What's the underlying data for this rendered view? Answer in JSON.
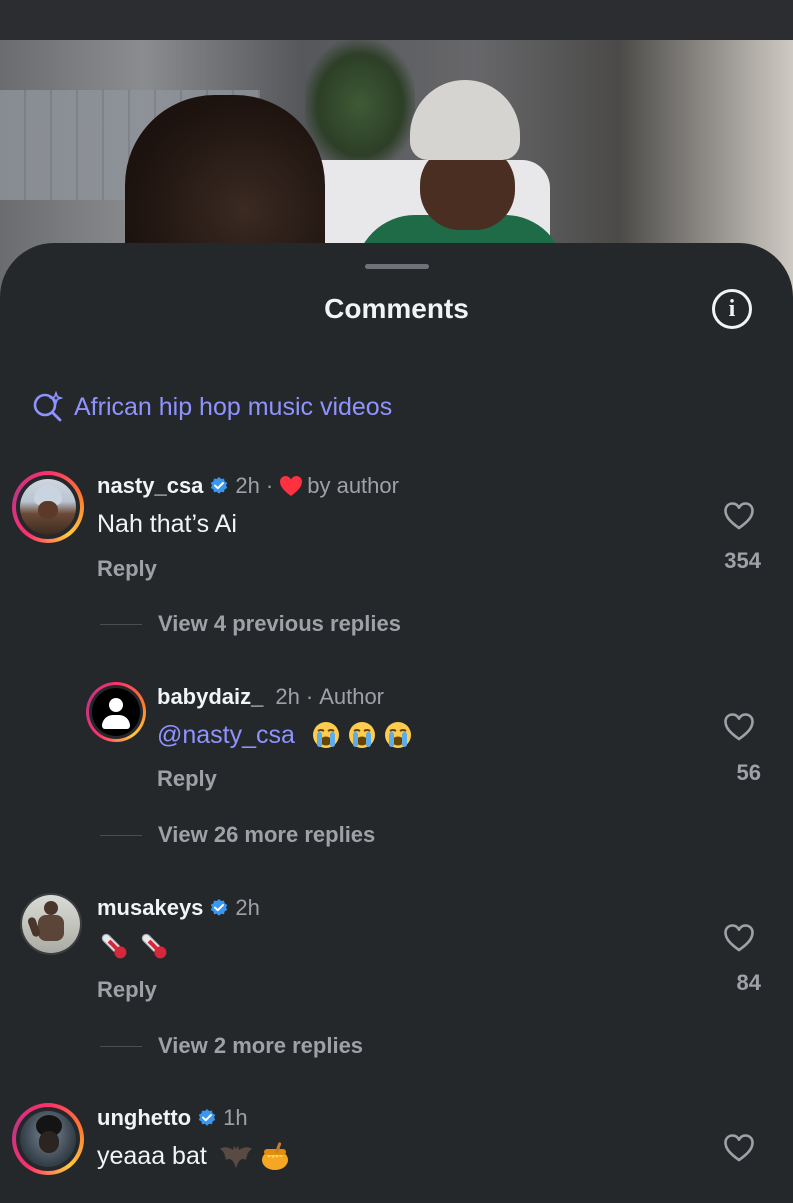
{
  "sheet": {
    "title": "Comments",
    "search_suggestion": "African hip hop music videos"
  },
  "comments": [
    {
      "username": "nasty_csa",
      "verified": true,
      "time": "2h",
      "liked_by_author_label": "by author",
      "text": "Nah that’s Ai",
      "reply_label": "Reply",
      "likes": "354",
      "view_replies_label": "View 4 previous replies"
    },
    {
      "username": "babydaiz_",
      "time": "2h",
      "author_label": "Author",
      "mention": "@nasty_csa",
      "emojis": [
        "loudly-crying-face",
        "loudly-crying-face",
        "loudly-crying-face"
      ],
      "reply_label": "Reply",
      "likes": "56",
      "view_replies_label": "View 26 more replies"
    },
    {
      "username": "musakeys",
      "verified": true,
      "time": "2h",
      "emojis": [
        "thermometer",
        "thermometer"
      ],
      "reply_label": "Reply",
      "likes": "84",
      "view_replies_label": "View 2 more replies"
    },
    {
      "username": "unghetto",
      "verified": true,
      "time": "1h",
      "text": "yeaaa bat",
      "emojis": [
        "bat",
        "honey-pot"
      ]
    }
  ],
  "colors": {
    "sheet_bg": "#25282b",
    "accent_link": "#8f93ff",
    "verified_badge": "#3897f0",
    "heart_red": "#ff3040",
    "muted_text": "#9ea1a6"
  }
}
